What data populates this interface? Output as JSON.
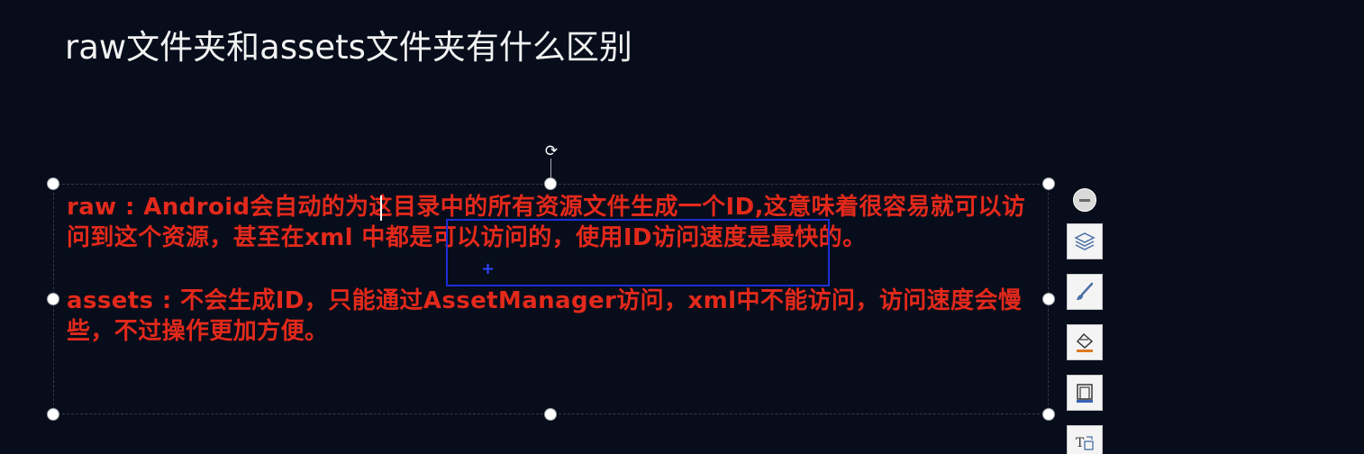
{
  "slide": {
    "title": "raw文件夹和assets文件夹有什么区别",
    "body": {
      "paragraph1": "raw : Android会自动的为这目录中的所有资源文件生成一个ID,这意味着很容易就可以访问到这个资源，甚至在xml 中都是可以访问的，使用ID访问速度是最快的。",
      "paragraph2": "assets : 不会生成ID，只能通过AssetManager访问，xml中不能访问，访问速度会慢些，不过操作更加方便。"
    }
  },
  "colors": {
    "background": "#070d1b",
    "title": "#f2f2f2",
    "body_text": "#e3291b",
    "selection": "#1b2fd6"
  },
  "toolbar": {
    "icons": [
      "collapse-icon",
      "layers-icon",
      "brush-icon",
      "fill-icon",
      "frame-icon",
      "text-wrap-icon"
    ]
  }
}
